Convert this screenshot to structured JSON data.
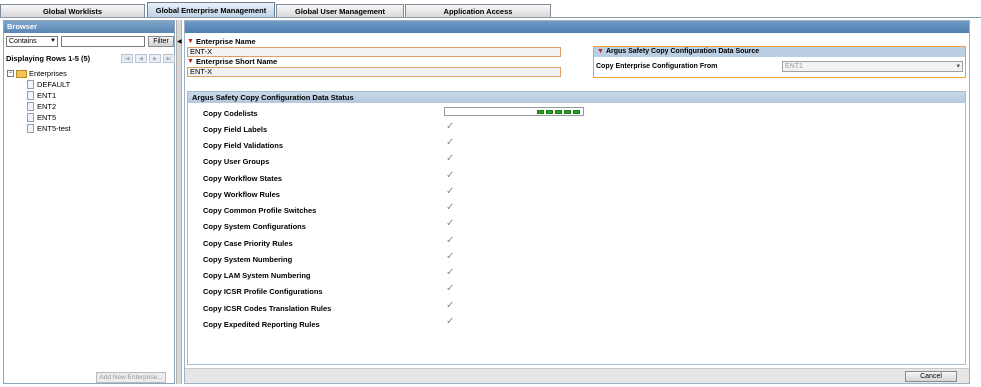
{
  "tabs": [
    {
      "label": "Global Worklists"
    },
    {
      "label": "Global Enterprise Management"
    },
    {
      "label": "Global User Management"
    },
    {
      "label": "Application Access"
    }
  ],
  "browser": {
    "title": "Browser",
    "filter_mode": "Contains",
    "filter_value": "",
    "filter_button": "Filter",
    "rows_label": "Displaying Rows 1-5 (5)",
    "tree_root": "Enterprises",
    "items": [
      "DEFAULT",
      "ENT1",
      "ENT2",
      "ENT5",
      "ENT5-test"
    ],
    "add_button": "Add New Enterprise..."
  },
  "form": {
    "enterprise_name_label": "Enterprise Name",
    "enterprise_name_value": "ENT-X",
    "short_name_label": "Enterprise Short Name",
    "short_name_value": "ENT-X",
    "source": {
      "title": "Argus Safety Copy Configuration Data Source",
      "copy_from_label": "Copy Enterprise Configuration From",
      "copy_from_value": "ENT1"
    }
  },
  "status": {
    "title": "Argus Safety Copy Configuration Data Status",
    "first_row": "Copy Codelists",
    "first_row_progress_segments": 5,
    "rows": [
      "Copy Field Labels",
      "Copy Field Validations",
      "Copy User Groups",
      "Copy Workflow States",
      "Copy Workflow Rules",
      "Copy Common Profile Switches",
      "Copy System Configurations",
      "Copy Case Priority Rules",
      "Copy System Numbering",
      "Copy LAM System Numbering",
      "Copy ICSR Profile Configurations",
      "Copy ICSR Codes Translation Rules",
      "Copy Expedited Reporting Rules"
    ]
  },
  "footer": {
    "cancel_button": "Cancel"
  },
  "colors": {
    "accent": "#5a86b3",
    "required": "#c02020",
    "progress": "#2aa02a",
    "highlight_border": "#f0a030"
  }
}
